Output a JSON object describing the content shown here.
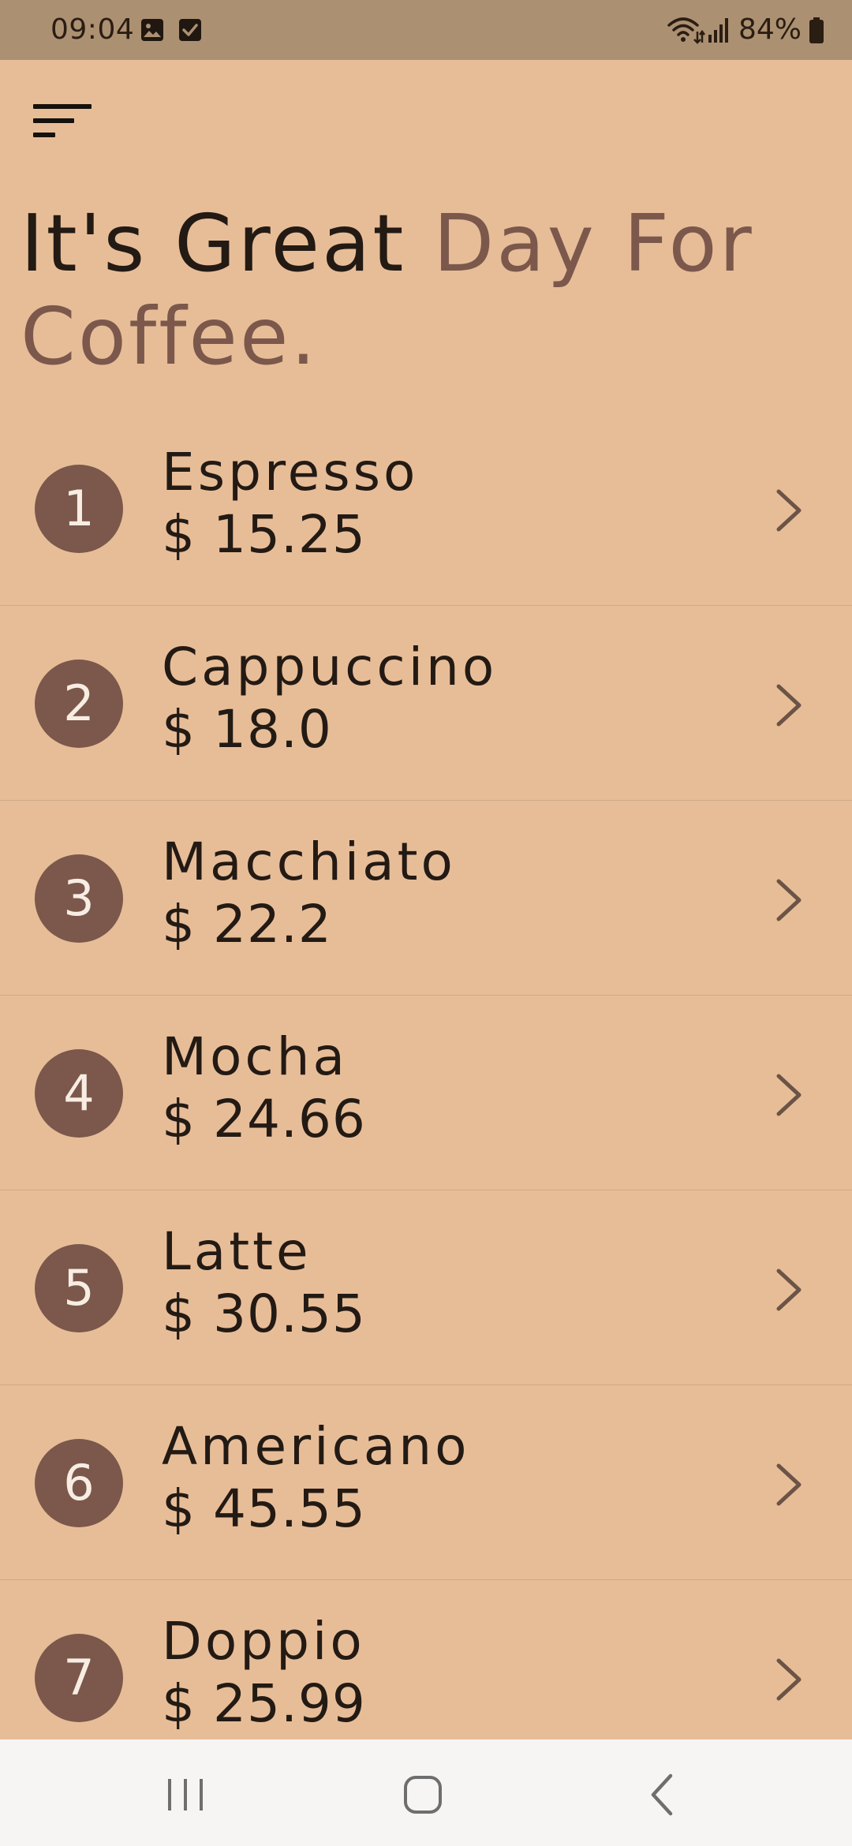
{
  "status_bar": {
    "time": "09:04",
    "left_icons": [
      "image-icon",
      "checkbox-icon"
    ],
    "right_icons": [
      "wifi-icon",
      "signal-icon",
      "battery-icon"
    ],
    "battery": "84%"
  },
  "header": {
    "menu_icon": "menu-icon",
    "headline_part1": "It's Great",
    "headline_part2": "Day For Coffee."
  },
  "colors": {
    "background": "#E7BD98",
    "status_bar": "#AC9072",
    "accent": "#7B584B",
    "text_dark": "#231a14",
    "nav_bar": "#F6F5F4"
  },
  "coffee_list": [
    {
      "number": "1",
      "name": "Espresso",
      "price": "$ 15.25"
    },
    {
      "number": "2",
      "name": "Cappuccino",
      "price": "$ 18.0"
    },
    {
      "number": "3",
      "name": "Macchiato",
      "price": "$ 22.2"
    },
    {
      "number": "4",
      "name": "Mocha",
      "price": "$ 24.66"
    },
    {
      "number": "5",
      "name": "Latte",
      "price": "$ 30.55"
    },
    {
      "number": "6",
      "name": "Americano",
      "price": "$ 45.55"
    },
    {
      "number": "7",
      "name": "Doppio",
      "price": "$ 25.99"
    }
  ],
  "nav_bar": {
    "buttons": [
      "recent-apps-icon",
      "home-icon",
      "back-icon"
    ]
  }
}
